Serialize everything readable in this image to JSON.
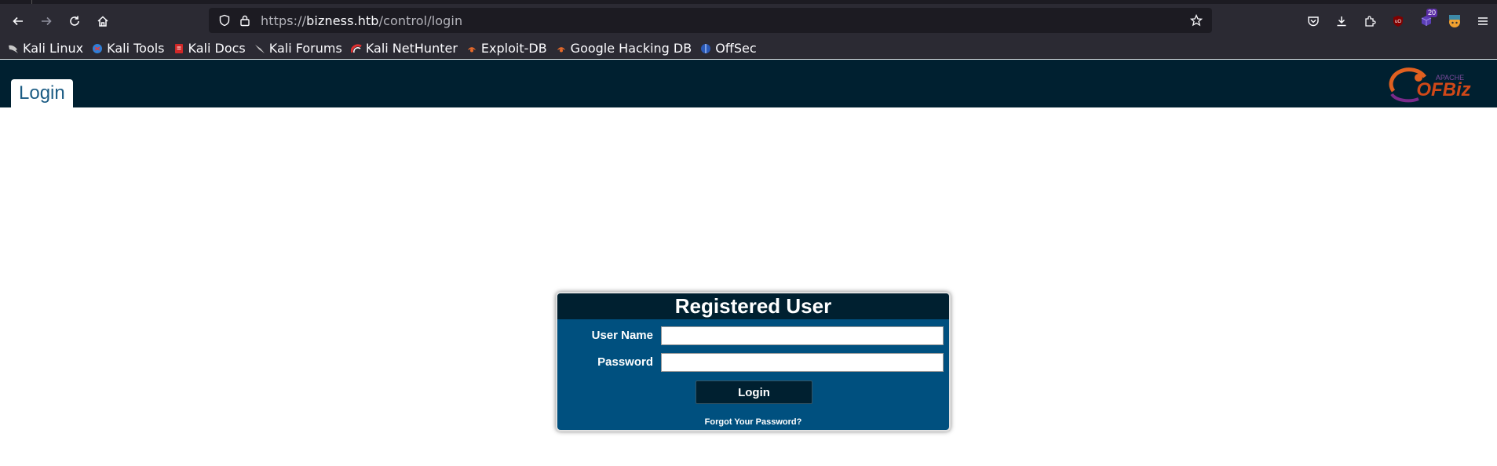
{
  "browser": {
    "url_prefix": "https://",
    "url_domain": "bizness.htb",
    "url_path": "/control/login",
    "extension_badge": "20",
    "bookmarks": [
      {
        "label": "Kali Linux",
        "icon": "kali-dragon-icon"
      },
      {
        "label": "Kali Tools",
        "icon": "kali-tools-icon"
      },
      {
        "label": "Kali Docs",
        "icon": "kali-docs-icon"
      },
      {
        "label": "Kali Forums",
        "icon": "kali-forums-icon"
      },
      {
        "label": "Kali NetHunter",
        "icon": "nethunter-icon"
      },
      {
        "label": "Exploit-DB",
        "icon": "exploitdb-icon"
      },
      {
        "label": "Google Hacking DB",
        "icon": "ghdb-icon"
      },
      {
        "label": "OffSec",
        "icon": "offsec-icon"
      }
    ]
  },
  "app": {
    "tab_label": "Login",
    "logo_text": "OFBiz",
    "logo_sub": "APACHE"
  },
  "login": {
    "title": "Registered User",
    "username_label": "User Name",
    "username_value": "",
    "password_label": "Password",
    "password_value": "",
    "submit_label": "Login",
    "forgot_label": "Forgot Your Password?"
  },
  "colors": {
    "header_bg": "#002030",
    "box_bg": "#00507f",
    "tab_text": "#1c5c84"
  }
}
